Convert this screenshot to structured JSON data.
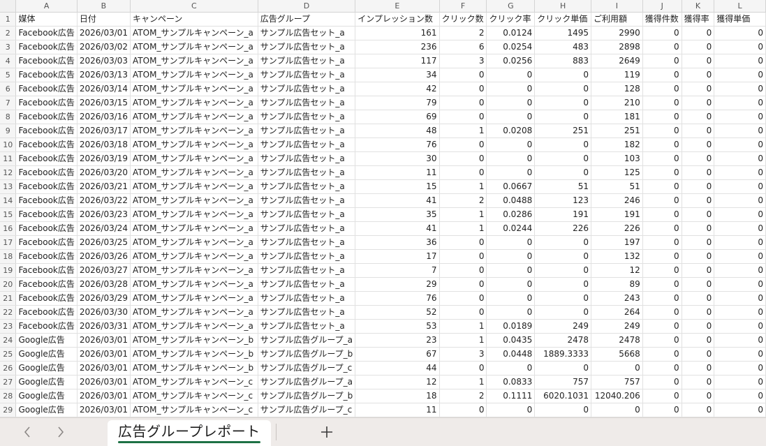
{
  "spreadsheet": {
    "column_letters": [
      "A",
      "B",
      "C",
      "D",
      "E",
      "F",
      "G",
      "H",
      "I",
      "J",
      "K",
      "L"
    ],
    "header_row_number": "1",
    "headers": [
      "媒体",
      "日付",
      "キャンペーン",
      "広告グループ",
      "インプレッション数",
      "クリック数",
      "クリック率",
      "クリック単価",
      "ご利用額",
      "獲得件数",
      "獲得率",
      "獲得単価"
    ],
    "rows": [
      {
        "n": "2",
        "v": [
          "Facebook広告",
          "2026/03/01",
          "ATOM_サンプルキャンペーン_a",
          "サンプル広告セット_a",
          "161",
          "2",
          "0.0124",
          "1495",
          "2990",
          "0",
          "0",
          "0"
        ]
      },
      {
        "n": "3",
        "v": [
          "Facebook広告",
          "2026/03/02",
          "ATOM_サンプルキャンペーン_a",
          "サンプル広告セット_a",
          "236",
          "6",
          "0.0254",
          "483",
          "2898",
          "0",
          "0",
          "0"
        ]
      },
      {
        "n": "4",
        "v": [
          "Facebook広告",
          "2026/03/03",
          "ATOM_サンプルキャンペーン_a",
          "サンプル広告セット_a",
          "117",
          "3",
          "0.0256",
          "883",
          "2649",
          "0",
          "0",
          "0"
        ]
      },
      {
        "n": "5",
        "v": [
          "Facebook広告",
          "2026/03/13",
          "ATOM_サンプルキャンペーン_a",
          "サンプル広告セット_a",
          "34",
          "0",
          "0",
          "0",
          "119",
          "0",
          "0",
          "0"
        ]
      },
      {
        "n": "6",
        "v": [
          "Facebook広告",
          "2026/03/14",
          "ATOM_サンプルキャンペーン_a",
          "サンプル広告セット_a",
          "42",
          "0",
          "0",
          "0",
          "128",
          "0",
          "0",
          "0"
        ]
      },
      {
        "n": "7",
        "v": [
          "Facebook広告",
          "2026/03/15",
          "ATOM_サンプルキャンペーン_a",
          "サンプル広告セット_a",
          "79",
          "0",
          "0",
          "0",
          "210",
          "0",
          "0",
          "0"
        ]
      },
      {
        "n": "8",
        "v": [
          "Facebook広告",
          "2026/03/16",
          "ATOM_サンプルキャンペーン_a",
          "サンプル広告セット_a",
          "69",
          "0",
          "0",
          "0",
          "181",
          "0",
          "0",
          "0"
        ]
      },
      {
        "n": "9",
        "v": [
          "Facebook広告",
          "2026/03/17",
          "ATOM_サンプルキャンペーン_a",
          "サンプル広告セット_a",
          "48",
          "1",
          "0.0208",
          "251",
          "251",
          "0",
          "0",
          "0"
        ]
      },
      {
        "n": "10",
        "v": [
          "Facebook広告",
          "2026/03/18",
          "ATOM_サンプルキャンペーン_a",
          "サンプル広告セット_a",
          "76",
          "0",
          "0",
          "0",
          "182",
          "0",
          "0",
          "0"
        ]
      },
      {
        "n": "11",
        "v": [
          "Facebook広告",
          "2026/03/19",
          "ATOM_サンプルキャンペーン_a",
          "サンプル広告セット_a",
          "30",
          "0",
          "0",
          "0",
          "103",
          "0",
          "0",
          "0"
        ]
      },
      {
        "n": "12",
        "v": [
          "Facebook広告",
          "2026/03/20",
          "ATOM_サンプルキャンペーン_a",
          "サンプル広告セット_a",
          "11",
          "0",
          "0",
          "0",
          "125",
          "0",
          "0",
          "0"
        ]
      },
      {
        "n": "13",
        "v": [
          "Facebook広告",
          "2026/03/21",
          "ATOM_サンプルキャンペーン_a",
          "サンプル広告セット_a",
          "15",
          "1",
          "0.0667",
          "51",
          "51",
          "0",
          "0",
          "0"
        ]
      },
      {
        "n": "14",
        "v": [
          "Facebook広告",
          "2026/03/22",
          "ATOM_サンプルキャンペーン_a",
          "サンプル広告セット_a",
          "41",
          "2",
          "0.0488",
          "123",
          "246",
          "0",
          "0",
          "0"
        ]
      },
      {
        "n": "15",
        "v": [
          "Facebook広告",
          "2026/03/23",
          "ATOM_サンプルキャンペーン_a",
          "サンプル広告セット_a",
          "35",
          "1",
          "0.0286",
          "191",
          "191",
          "0",
          "0",
          "0"
        ]
      },
      {
        "n": "16",
        "v": [
          "Facebook広告",
          "2026/03/24",
          "ATOM_サンプルキャンペーン_a",
          "サンプル広告セット_a",
          "41",
          "1",
          "0.0244",
          "226",
          "226",
          "0",
          "0",
          "0"
        ]
      },
      {
        "n": "17",
        "v": [
          "Facebook広告",
          "2026/03/25",
          "ATOM_サンプルキャンペーン_a",
          "サンプル広告セット_a",
          "36",
          "0",
          "0",
          "0",
          "197",
          "0",
          "0",
          "0"
        ]
      },
      {
        "n": "18",
        "v": [
          "Facebook広告",
          "2026/03/26",
          "ATOM_サンプルキャンペーン_a",
          "サンプル広告セット_a",
          "17",
          "0",
          "0",
          "0",
          "132",
          "0",
          "0",
          "0"
        ]
      },
      {
        "n": "19",
        "v": [
          "Facebook広告",
          "2026/03/27",
          "ATOM_サンプルキャンペーン_a",
          "サンプル広告セット_a",
          "7",
          "0",
          "0",
          "0",
          "12",
          "0",
          "0",
          "0"
        ]
      },
      {
        "n": "20",
        "v": [
          "Facebook広告",
          "2026/03/28",
          "ATOM_サンプルキャンペーン_a",
          "サンプル広告セット_a",
          "29",
          "0",
          "0",
          "0",
          "89",
          "0",
          "0",
          "0"
        ]
      },
      {
        "n": "21",
        "v": [
          "Facebook広告",
          "2026/03/29",
          "ATOM_サンプルキャンペーン_a",
          "サンプル広告セット_a",
          "76",
          "0",
          "0",
          "0",
          "243",
          "0",
          "0",
          "0"
        ]
      },
      {
        "n": "22",
        "v": [
          "Facebook広告",
          "2026/03/30",
          "ATOM_サンプルキャンペーン_a",
          "サンプル広告セット_a",
          "52",
          "0",
          "0",
          "0",
          "264",
          "0",
          "0",
          "0"
        ]
      },
      {
        "n": "23",
        "v": [
          "Facebook広告",
          "2026/03/31",
          "ATOM_サンプルキャンペーン_a",
          "サンプル広告セット_a",
          "53",
          "1",
          "0.0189",
          "249",
          "249",
          "0",
          "0",
          "0"
        ]
      },
      {
        "n": "24",
        "v": [
          "Google広告",
          "2026/03/01",
          "ATOM_サンプルキャンペーン_b",
          "サンプル広告グループ_a",
          "23",
          "1",
          "0.0435",
          "2478",
          "2478",
          "0",
          "0",
          "0"
        ]
      },
      {
        "n": "25",
        "v": [
          "Google広告",
          "2026/03/01",
          "ATOM_サンプルキャンペーン_b",
          "サンプル広告グループ_b",
          "67",
          "3",
          "0.0448",
          "1889.3333",
          "5668",
          "0",
          "0",
          "0"
        ]
      },
      {
        "n": "26",
        "v": [
          "Google広告",
          "2026/03/01",
          "ATOM_サンプルキャンペーン_b",
          "サンプル広告グループ_c",
          "44",
          "0",
          "0",
          "0",
          "0",
          "0",
          "0",
          "0"
        ]
      },
      {
        "n": "27",
        "v": [
          "Google広告",
          "2026/03/01",
          "ATOM_サンプルキャンペーン_c",
          "サンプル広告グループ_a",
          "12",
          "1",
          "0.0833",
          "757",
          "757",
          "0",
          "0",
          "0"
        ]
      },
      {
        "n": "28",
        "v": [
          "Google広告",
          "2026/03/01",
          "ATOM_サンプルキャンペーン_c",
          "サンプル広告グループ_b",
          "18",
          "2",
          "0.1111",
          "6020.1031",
          "12040.206",
          "0",
          "0",
          "0"
        ]
      },
      {
        "n": "29",
        "v": [
          "Google広告",
          "2026/03/01",
          "ATOM_サンプルキャンペーン_c",
          "サンプル広告グループ_c",
          "11",
          "0",
          "0",
          "0",
          "0",
          "0",
          "0",
          "0"
        ]
      }
    ]
  },
  "tabbar": {
    "prev_icon": "chevron-left-icon",
    "next_icon": "chevron-right-icon",
    "active_sheet": "広告グループレポート",
    "add_icon": "plus-icon",
    "accent_color": "#1e7145"
  }
}
